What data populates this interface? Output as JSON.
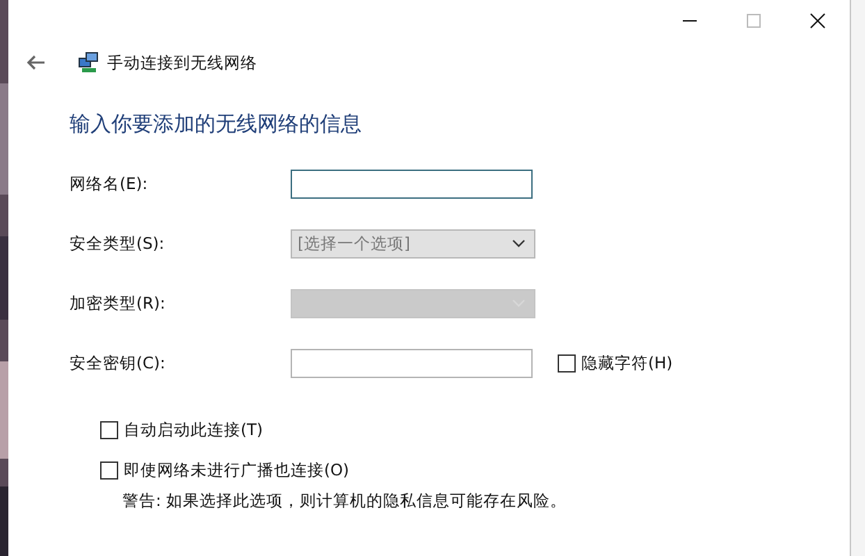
{
  "window": {
    "title": "手动连接到无线网络"
  },
  "heading": "输入你要添加的无线网络的信息",
  "fields": [
    {
      "label": "网络名(E):",
      "kind": "text",
      "focused": true,
      "disabled": false
    },
    {
      "label": "安全类型(S):",
      "kind": "select",
      "value": "[选择一个选项]",
      "disabled": false
    },
    {
      "label": "加密类型(R):",
      "kind": "select",
      "disabled": true
    },
    {
      "label": "安全密钥(C):",
      "kind": "text",
      "focused": false,
      "disabled": false,
      "checkbox": {
        "label": "隐藏字符(H)",
        "checked": false
      }
    }
  ],
  "options": [
    {
      "label": "自动启动此连接(T)",
      "checked": false
    },
    {
      "label": "即使网络未进行广播也连接(O)",
      "checked": false,
      "note": "警告: 如果选择此选项，则计算机的隐私信息可能存在风险。"
    }
  ]
}
